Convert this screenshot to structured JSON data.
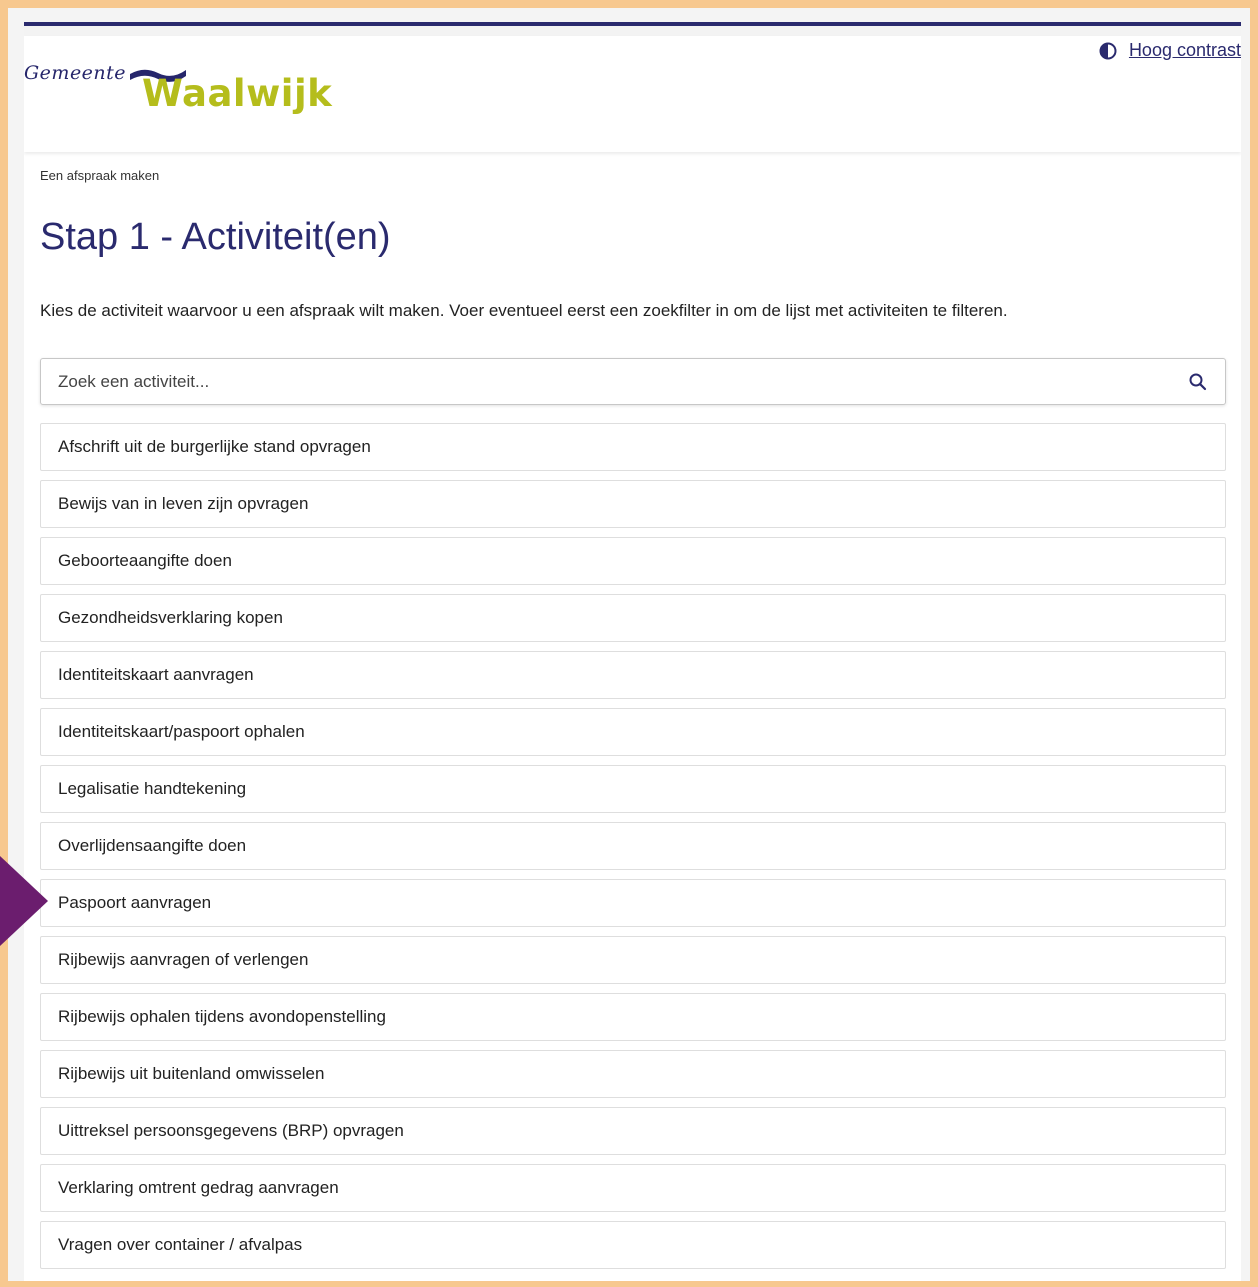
{
  "logo": {
    "small_text": "Gemeente",
    "big_text": "Waalwijk"
  },
  "contrast": {
    "label": "Hoog contrast",
    "icon": "contrast-icon"
  },
  "breadcrumb": "Een afspraak maken",
  "page_title": "Stap 1 - Activiteit(en)",
  "intro": "Kies de activiteit waarvoor u een afspraak wilt maken. Voer eventueel eerst een zoekfilter in om de lijst met activiteiten te filteren.",
  "search": {
    "placeholder": "Zoek een activiteit...",
    "value": "",
    "icon": "search-icon"
  },
  "activities": [
    {
      "label": "Afschrift uit de burgerlijke stand opvragen"
    },
    {
      "label": "Bewijs van in leven zijn opvragen"
    },
    {
      "label": "Geboorteaangifte doen"
    },
    {
      "label": "Gezondheidsverklaring kopen"
    },
    {
      "label": "Identiteitskaart aanvragen"
    },
    {
      "label": "Identiteitskaart/paspoort ophalen"
    },
    {
      "label": "Legalisatie handtekening"
    },
    {
      "label": "Overlijdensaangifte doen"
    },
    {
      "label": "Paspoort aanvragen"
    },
    {
      "label": "Rijbewijs aanvragen of verlengen"
    },
    {
      "label": "Rijbewijs ophalen tijdens avondopenstelling"
    },
    {
      "label": "Rijbewijs uit buitenland omwisselen"
    },
    {
      "label": "Uittreksel persoonsgegevens (BRP) opvragen"
    },
    {
      "label": "Verklaring omtrent gedrag aanvragen"
    },
    {
      "label": "Vragen over container / afvalpas"
    }
  ],
  "colors": {
    "brand_navy": "#2a2a6e",
    "brand_green": "#b5bd1c",
    "frame": "#f7c88f",
    "pointer_arrow": "#6b1d6e"
  }
}
